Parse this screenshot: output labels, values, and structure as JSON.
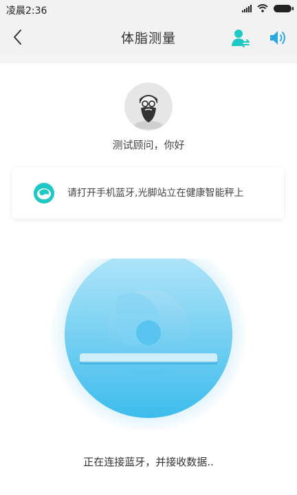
{
  "status_bar": {
    "time": "凌晨2:36"
  },
  "nav": {
    "title": "体脂测量"
  },
  "advisor": {
    "greeting": "测试顾问，你好"
  },
  "tip": {
    "text": "请打开手机蓝牙,光脚站立在健康智能秤上"
  },
  "footer": {
    "status": "正在连接蓝牙，并接收数据.."
  },
  "colors": {
    "accent": "#1ec8c4",
    "scale_blue": "#55c8f1"
  },
  "icons": {
    "back": "chevron-left-icon",
    "user_switch": "user-switch-icon",
    "volume": "volume-icon",
    "tip": "scale-tip-icon"
  }
}
